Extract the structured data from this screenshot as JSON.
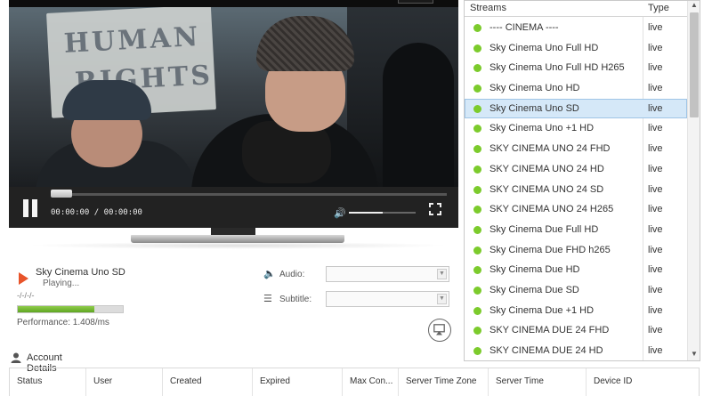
{
  "player": {
    "time_display": "00:00:00 / 00:00:00",
    "progress": 0.0,
    "volume": 0.5,
    "sign_text_line1": "HUMAN",
    "sign_text_line2": "RIGHTS"
  },
  "now_playing": {
    "title": "Sky Cinema Uno SD",
    "status": "Playing...",
    "info": "-/-/-/-",
    "performance_label": "Performance:  1.408/ms",
    "performance_level": 0.73,
    "performance_color": "#6db32b"
  },
  "options": {
    "audio_label": "Audio:",
    "audio_value": "",
    "subtitle_label": "Subtitle:",
    "subtitle_value": ""
  },
  "account": {
    "title": "Account Details",
    "columns": [
      "Status",
      "User",
      "Created",
      "Expired",
      "Max Con...",
      "Server Time Zone",
      "Server Time",
      "Device ID"
    ]
  },
  "streams": {
    "header_name": "Streams",
    "header_type": "Type",
    "selected_index": 4,
    "selected_color": "#d5e8f8",
    "live_dot_color": "#7ccb2c",
    "items": [
      {
        "name": "---- CINEMA ----",
        "type": "live"
      },
      {
        "name": "Sky Cinema Uno Full HD",
        "type": "live"
      },
      {
        "name": "Sky Cinema Uno Full HD H265",
        "type": "live"
      },
      {
        "name": "Sky Cinema Uno HD",
        "type": "live"
      },
      {
        "name": "Sky Cinema Uno SD",
        "type": "live"
      },
      {
        "name": "Sky Cinema Uno +1 HD",
        "type": "live"
      },
      {
        "name": "SKY CINEMA UNO 24 FHD",
        "type": "live"
      },
      {
        "name": "SKY CINEMA UNO 24 HD",
        "type": "live"
      },
      {
        "name": "SKY CINEMA UNO 24 SD",
        "type": "live"
      },
      {
        "name": "SKY CINEMA UNO 24 H265",
        "type": "live"
      },
      {
        "name": "Sky Cinema Due Full HD",
        "type": "live"
      },
      {
        "name": "Sky Cinema Due FHD h265",
        "type": "live"
      },
      {
        "name": "Sky Cinema Due HD",
        "type": "live"
      },
      {
        "name": "Sky Cinema Due SD",
        "type": "live"
      },
      {
        "name": "Sky Cinema Due +1 HD",
        "type": "live"
      },
      {
        "name": "SKY CINEMA DUE 24 FHD",
        "type": "live"
      },
      {
        "name": "SKY CINEMA DUE 24 HD",
        "type": "live"
      }
    ]
  }
}
